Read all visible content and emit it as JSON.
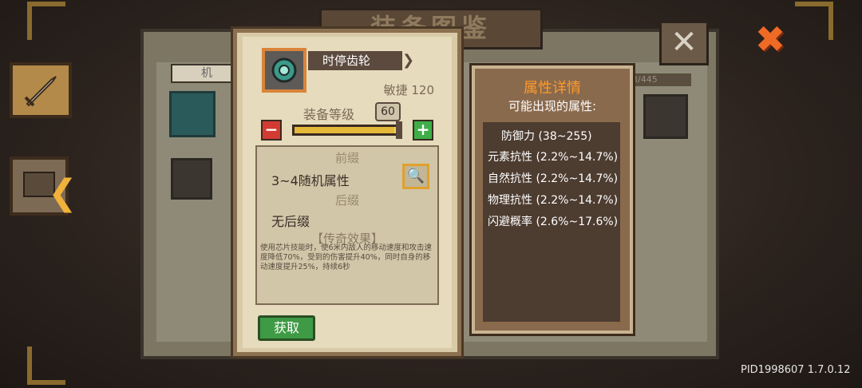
{
  "background": {
    "banner_text": "装备图鉴",
    "filter_label": "机",
    "collection_count": "3/445",
    "close_icon": "x-icon",
    "close_red_icon": "x-icon"
  },
  "item_card": {
    "name": "时停齿轮",
    "agility_label": "敏捷 120",
    "level_label": "装备等级",
    "level_value": "60",
    "level_slider_fraction": 0.96,
    "prefix_title": "前缀",
    "prefix_text": "3~4随机属性",
    "suffix_title": "后缀",
    "suffix_text": "无后缀",
    "legend_title": "【传奇效果】",
    "legend_desc": "使用芯片技能时，使6米内敌人的移动速度和攻击速度降低70%，受到的伤害提升40%，同时自身的移动速度提升25%，持续6秒",
    "obtain_label": "获取",
    "minus_label": "−",
    "plus_label": "+"
  },
  "attributes_panel": {
    "title": "属性详情",
    "subtitle": "可能出现的属性:",
    "rows": [
      "防御力 (38~255)",
      "元素抗性 (2.2%~14.7%)",
      "自然抗性 (2.2%~14.7%)",
      "物理抗性 (2.2%~14.7%)",
      "闪避概率 (2.6%~17.6%)"
    ]
  },
  "footer": {
    "version": "PID1998607 1.7.0.12"
  },
  "colors": {
    "accent_orange": "#ff9a2a",
    "obtain_green": "#3e9a44",
    "minus_red": "#d23a32",
    "plus_green": "#3fae48"
  }
}
